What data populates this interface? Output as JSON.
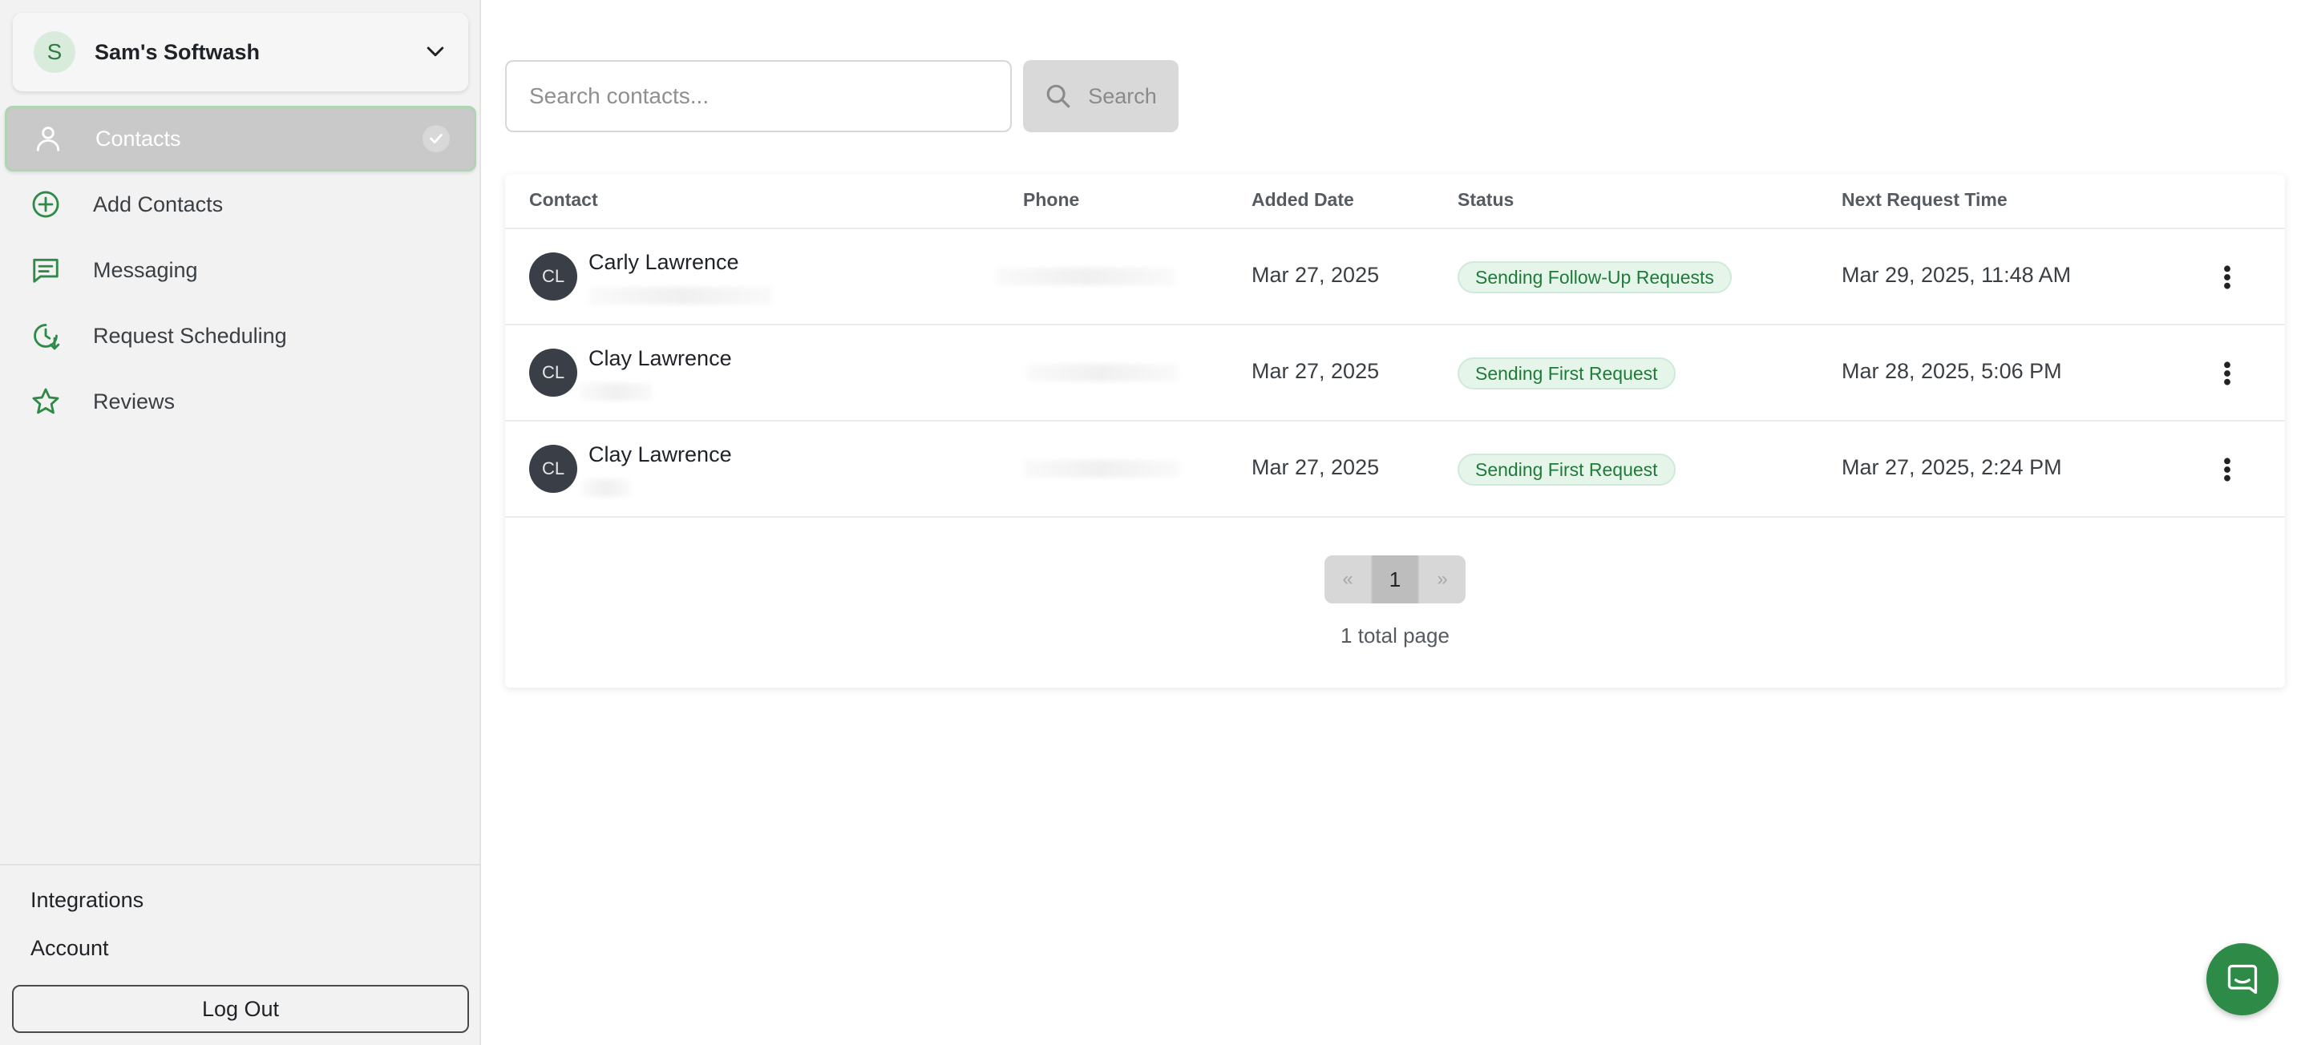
{
  "org": {
    "initial": "S",
    "name": "Sam's Softwash"
  },
  "nav": {
    "items": [
      {
        "label": "Contacts",
        "icon": "user-icon",
        "active": true
      },
      {
        "label": "Add Contacts",
        "icon": "plus-circle-icon"
      },
      {
        "label": "Messaging",
        "icon": "message-icon"
      },
      {
        "label": "Request Scheduling",
        "icon": "clock-icon"
      },
      {
        "label": "Reviews",
        "icon": "star-icon"
      }
    ]
  },
  "sidebar_bottom": {
    "integrations": "Integrations",
    "account": "Account",
    "logout": "Log Out"
  },
  "search": {
    "placeholder": "Search contacts...",
    "value": "",
    "button_label": "Search"
  },
  "table": {
    "headers": {
      "contact": "Contact",
      "phone": "Phone",
      "added_date": "Added Date",
      "status": "Status",
      "next_request_time": "Next Request Time"
    },
    "rows": [
      {
        "initials": "CL",
        "name": "Carly Lawrence",
        "added_date": "Mar 27, 2025",
        "status": "Sending Follow-Up Requests",
        "next_request_time": "Mar 29, 2025, 11:48 AM"
      },
      {
        "initials": "CL",
        "name": "Clay Lawrence",
        "added_date": "Mar 27, 2025",
        "status": "Sending First Request",
        "next_request_time": "Mar 28, 2025, 5:06 PM"
      },
      {
        "initials": "CL",
        "name": "Clay Lawrence",
        "added_date": "Mar 27, 2025",
        "status": "Sending First Request",
        "next_request_time": "Mar 27, 2025, 2:24 PM"
      }
    ]
  },
  "pagination": {
    "prev": "«",
    "current": "1",
    "next": "»",
    "summary": "1 total page"
  },
  "colors": {
    "accent": "#2e8b47",
    "badge_bg": "#e6f5e9",
    "badge_text": "#1f7a3a",
    "sidebar_bg": "#f2f2f2",
    "avatar_bg": "#3a3f47"
  }
}
